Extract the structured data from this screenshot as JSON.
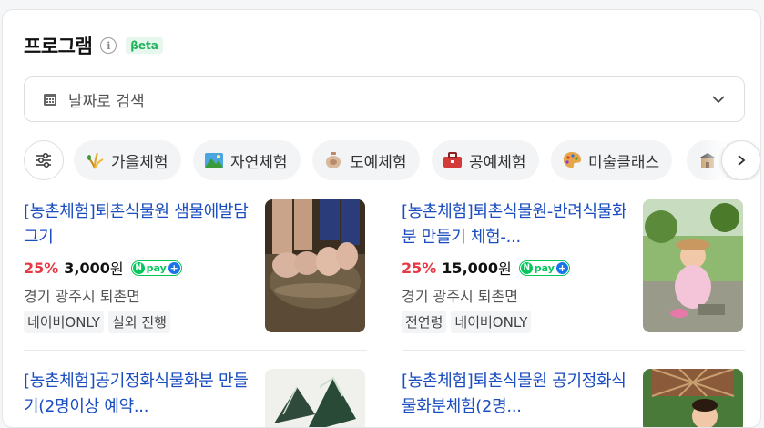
{
  "header": {
    "title": "프로그램",
    "info_icon": "info-icon",
    "badge": "βeta"
  },
  "date_search": {
    "label": "날짜로 검색",
    "icon": "calendar-icon"
  },
  "chips": [
    {
      "label": "가을체험",
      "icon": "autumn-icon"
    },
    {
      "label": "자연체험",
      "icon": "nature-icon"
    },
    {
      "label": "도예체험",
      "icon": "pottery-icon"
    },
    {
      "label": "공예체험",
      "icon": "craft-icon"
    },
    {
      "label": "미술클래스",
      "icon": "palette-icon"
    },
    {
      "label": "",
      "icon": "house-icon"
    }
  ],
  "products": [
    {
      "title": "[농촌체험]퇴촌식물원 샘물에발담그기",
      "discount": "25%",
      "price": "3,000",
      "currency": "원",
      "npay": "pay",
      "location": "경기 광주시 퇴촌면",
      "tags": [
        "네이버ONLY",
        "실외 진행"
      ]
    },
    {
      "title": "[농촌체험]퇴촌식물원-반려식물화분 만들기 체험-...",
      "discount": "25%",
      "price": "15,000",
      "currency": "원",
      "npay": "pay",
      "location": "경기 광주시 퇴촌면",
      "tags": [
        "전연령",
        "네이버ONLY"
      ]
    },
    {
      "title": "[농촌체험]공기정화식물화분 만들기(2명이상 예약...",
      "discount": "",
      "price": "",
      "currency": "",
      "npay": "",
      "location": "",
      "tags": []
    },
    {
      "title": "[농촌체험]퇴촌식물원 공기정화식물화분체험(2명...",
      "discount": "",
      "price": "",
      "currency": "",
      "npay": "",
      "location": "",
      "tags": []
    }
  ],
  "colors": {
    "link": "#1a4dbf",
    "discount": "#e63946",
    "npay": "#03c75a",
    "beta": "#1eb35b"
  }
}
